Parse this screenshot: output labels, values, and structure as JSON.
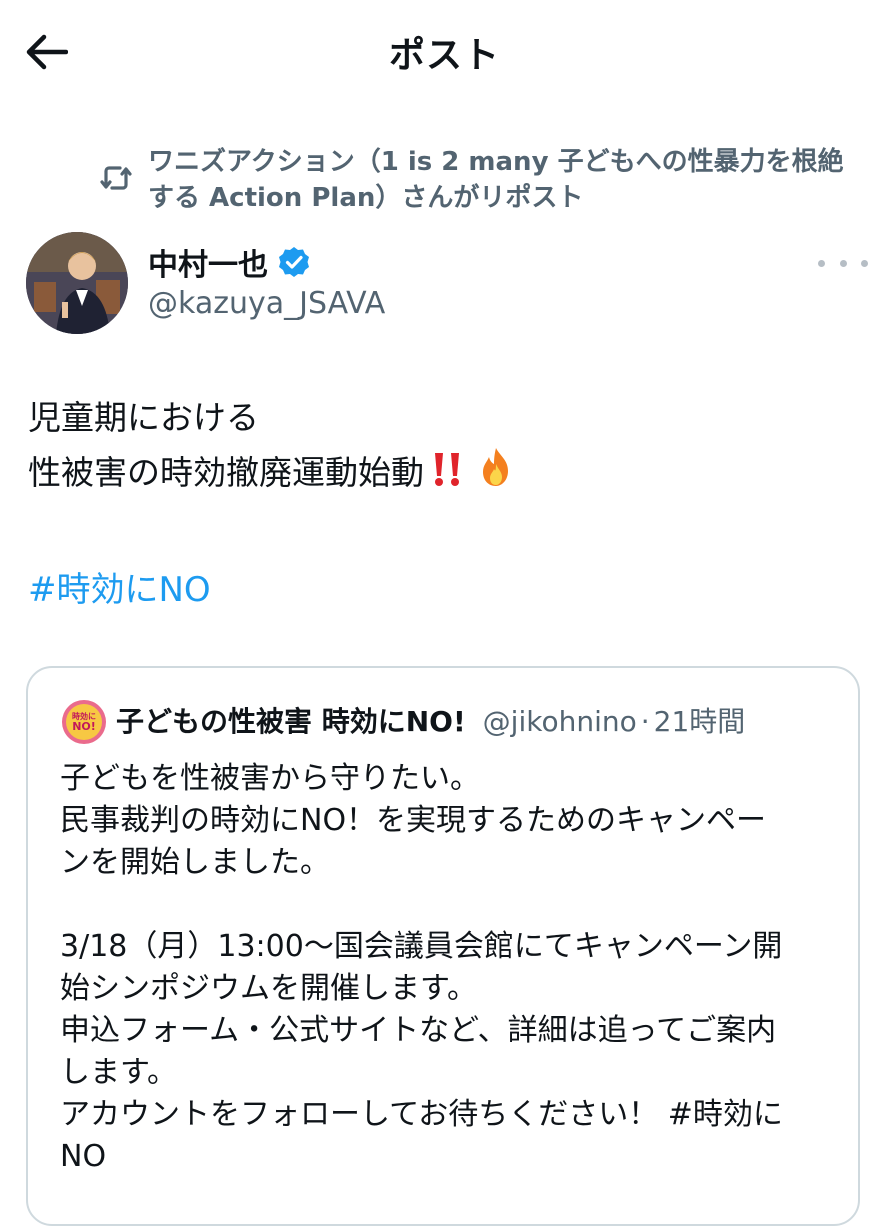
{
  "header": {
    "title": "ポスト",
    "back_icon": "arrow-left-icon"
  },
  "repost": {
    "icon": "repost-icon",
    "text": "ワニズアクション（1 is 2 many 子どもへの性暴力を根絶する Action Plan）さんがリポスト"
  },
  "author": {
    "name": "中村一也",
    "handle": "@kazuya_JSAVA",
    "verified": true
  },
  "post": {
    "lines": [
      "児童期における",
      "性被害の時効撤廃運動始動"
    ],
    "emojis": "‼️🔥",
    "hashtag": "#時効にNO"
  },
  "quote": {
    "avatar_text_top": "時効に",
    "avatar_text_bottom": "NO!",
    "name": "子どもの性被害 時効にNO!",
    "handle": "@jikohnino",
    "separator": "·",
    "time": "21時間",
    "lines": [
      "子どもを性被害から守りたい。",
      "民事裁判の時効にNO！を実現するためのキャンペー",
      "ンを開始しました。",
      "",
      "3/18（月）13:00〜国会議員会館にてキャンペーン開",
      "始シンポジウムを開催します。",
      "申込フォーム・公式サイトなど、詳細は追ってご案内",
      "します。",
      "アカウントをフォローしてお待ちください！ #時効に",
      "NO"
    ]
  },
  "colors": {
    "link": "#1d9bf0",
    "secondary_text": "#536471",
    "verified": "#1d9bf0",
    "border": "#cfd9de"
  }
}
